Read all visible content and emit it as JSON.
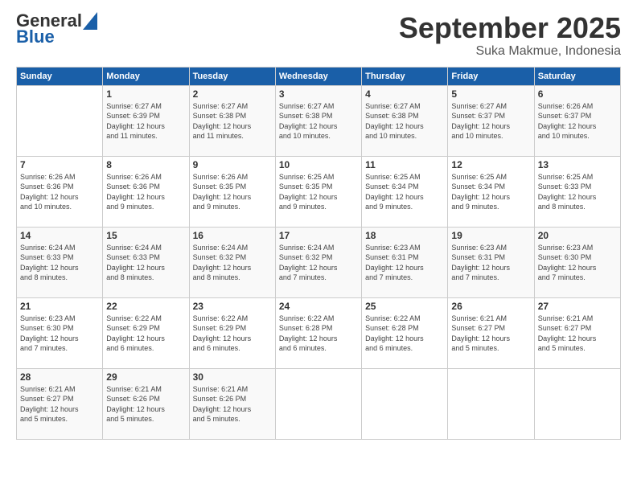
{
  "logo": {
    "line1": "General",
    "line2": "Blue"
  },
  "header": {
    "month": "September 2025",
    "location": "Suka Makmue, Indonesia"
  },
  "days_of_week": [
    "Sunday",
    "Monday",
    "Tuesday",
    "Wednesday",
    "Thursday",
    "Friday",
    "Saturday"
  ],
  "weeks": [
    [
      {
        "day": "",
        "info": ""
      },
      {
        "day": "1",
        "info": "Sunrise: 6:27 AM\nSunset: 6:39 PM\nDaylight: 12 hours\nand 11 minutes."
      },
      {
        "day": "2",
        "info": "Sunrise: 6:27 AM\nSunset: 6:38 PM\nDaylight: 12 hours\nand 11 minutes."
      },
      {
        "day": "3",
        "info": "Sunrise: 6:27 AM\nSunset: 6:38 PM\nDaylight: 12 hours\nand 10 minutes."
      },
      {
        "day": "4",
        "info": "Sunrise: 6:27 AM\nSunset: 6:38 PM\nDaylight: 12 hours\nand 10 minutes."
      },
      {
        "day": "5",
        "info": "Sunrise: 6:27 AM\nSunset: 6:37 PM\nDaylight: 12 hours\nand 10 minutes."
      },
      {
        "day": "6",
        "info": "Sunrise: 6:26 AM\nSunset: 6:37 PM\nDaylight: 12 hours\nand 10 minutes."
      }
    ],
    [
      {
        "day": "7",
        "info": "Sunrise: 6:26 AM\nSunset: 6:36 PM\nDaylight: 12 hours\nand 10 minutes."
      },
      {
        "day": "8",
        "info": "Sunrise: 6:26 AM\nSunset: 6:36 PM\nDaylight: 12 hours\nand 9 minutes."
      },
      {
        "day": "9",
        "info": "Sunrise: 6:26 AM\nSunset: 6:35 PM\nDaylight: 12 hours\nand 9 minutes."
      },
      {
        "day": "10",
        "info": "Sunrise: 6:25 AM\nSunset: 6:35 PM\nDaylight: 12 hours\nand 9 minutes."
      },
      {
        "day": "11",
        "info": "Sunrise: 6:25 AM\nSunset: 6:34 PM\nDaylight: 12 hours\nand 9 minutes."
      },
      {
        "day": "12",
        "info": "Sunrise: 6:25 AM\nSunset: 6:34 PM\nDaylight: 12 hours\nand 9 minutes."
      },
      {
        "day": "13",
        "info": "Sunrise: 6:25 AM\nSunset: 6:33 PM\nDaylight: 12 hours\nand 8 minutes."
      }
    ],
    [
      {
        "day": "14",
        "info": "Sunrise: 6:24 AM\nSunset: 6:33 PM\nDaylight: 12 hours\nand 8 minutes."
      },
      {
        "day": "15",
        "info": "Sunrise: 6:24 AM\nSunset: 6:33 PM\nDaylight: 12 hours\nand 8 minutes."
      },
      {
        "day": "16",
        "info": "Sunrise: 6:24 AM\nSunset: 6:32 PM\nDaylight: 12 hours\nand 8 minutes."
      },
      {
        "day": "17",
        "info": "Sunrise: 6:24 AM\nSunset: 6:32 PM\nDaylight: 12 hours\nand 7 minutes."
      },
      {
        "day": "18",
        "info": "Sunrise: 6:23 AM\nSunset: 6:31 PM\nDaylight: 12 hours\nand 7 minutes."
      },
      {
        "day": "19",
        "info": "Sunrise: 6:23 AM\nSunset: 6:31 PM\nDaylight: 12 hours\nand 7 minutes."
      },
      {
        "day": "20",
        "info": "Sunrise: 6:23 AM\nSunset: 6:30 PM\nDaylight: 12 hours\nand 7 minutes."
      }
    ],
    [
      {
        "day": "21",
        "info": "Sunrise: 6:23 AM\nSunset: 6:30 PM\nDaylight: 12 hours\nand 7 minutes."
      },
      {
        "day": "22",
        "info": "Sunrise: 6:22 AM\nSunset: 6:29 PM\nDaylight: 12 hours\nand 6 minutes."
      },
      {
        "day": "23",
        "info": "Sunrise: 6:22 AM\nSunset: 6:29 PM\nDaylight: 12 hours\nand 6 minutes."
      },
      {
        "day": "24",
        "info": "Sunrise: 6:22 AM\nSunset: 6:28 PM\nDaylight: 12 hours\nand 6 minutes."
      },
      {
        "day": "25",
        "info": "Sunrise: 6:22 AM\nSunset: 6:28 PM\nDaylight: 12 hours\nand 6 minutes."
      },
      {
        "day": "26",
        "info": "Sunrise: 6:21 AM\nSunset: 6:27 PM\nDaylight: 12 hours\nand 5 minutes."
      },
      {
        "day": "27",
        "info": "Sunrise: 6:21 AM\nSunset: 6:27 PM\nDaylight: 12 hours\nand 5 minutes."
      }
    ],
    [
      {
        "day": "28",
        "info": "Sunrise: 6:21 AM\nSunset: 6:27 PM\nDaylight: 12 hours\nand 5 minutes."
      },
      {
        "day": "29",
        "info": "Sunrise: 6:21 AM\nSunset: 6:26 PM\nDaylight: 12 hours\nand 5 minutes."
      },
      {
        "day": "30",
        "info": "Sunrise: 6:21 AM\nSunset: 6:26 PM\nDaylight: 12 hours\nand 5 minutes."
      },
      {
        "day": "",
        "info": ""
      },
      {
        "day": "",
        "info": ""
      },
      {
        "day": "",
        "info": ""
      },
      {
        "day": "",
        "info": ""
      }
    ]
  ]
}
